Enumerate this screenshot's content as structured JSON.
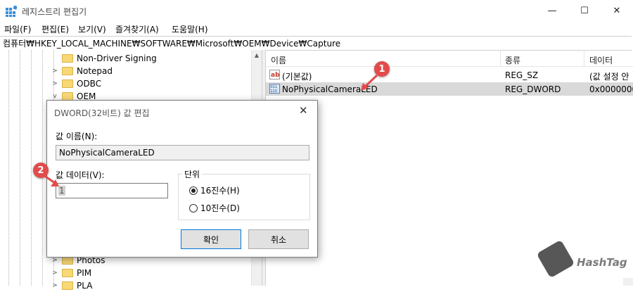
{
  "window": {
    "title": "레지스트리 편집기"
  },
  "menu": [
    "파일(F)",
    "편집(E)",
    "보기(V)",
    "즐겨찾기(A)",
    "도움말(H)"
  ],
  "address": "컴퓨터₩HKEY_LOCAL_MACHINE₩SOFTWARE₩Microsoft₩OEM₩Device₩Capture",
  "tree": {
    "top_items": [
      {
        "label": "Non-Driver Signing",
        "expander": ""
      },
      {
        "label": "Notepad",
        "expander": ">"
      },
      {
        "label": "ODBC",
        "expander": ">"
      },
      {
        "label": "OEM",
        "expander": "v"
      }
    ],
    "bottom_items": [
      {
        "label": "Photos",
        "expander": ">"
      },
      {
        "label": "PIM",
        "expander": ">"
      },
      {
        "label": "PLA",
        "expander": ">"
      }
    ]
  },
  "list": {
    "headers": {
      "name": "이름",
      "type": "종류",
      "data": "데이터"
    },
    "rows": [
      {
        "name": "(기본값)",
        "type": "REG_SZ",
        "data": "(값 설정 안",
        "icon": "string-value-icon"
      },
      {
        "name": "NoPhysicalCameraLED",
        "type": "REG_DWORD",
        "data": "0x0000000",
        "icon": "dword-value-icon"
      }
    ]
  },
  "dialog": {
    "title": "DWORD(32비트) 값 편집",
    "value_name_label": "값 이름(N):",
    "value_name": "NoPhysicalCameraLED",
    "value_data_label": "값 데이터(V):",
    "value_data": "1",
    "base_label": "단위",
    "radio_hex": "16진수(H)",
    "radio_dec": "10진수(D)",
    "selected_base": "hex",
    "ok": "확인",
    "cancel": "취소"
  },
  "annotations": {
    "badge1": "1",
    "badge2": "2"
  },
  "watermark": {
    "text": "HashTag"
  },
  "colors": {
    "badge": "#e24b4b",
    "selection": "#d9d9d9",
    "folder": "#f8d775"
  }
}
